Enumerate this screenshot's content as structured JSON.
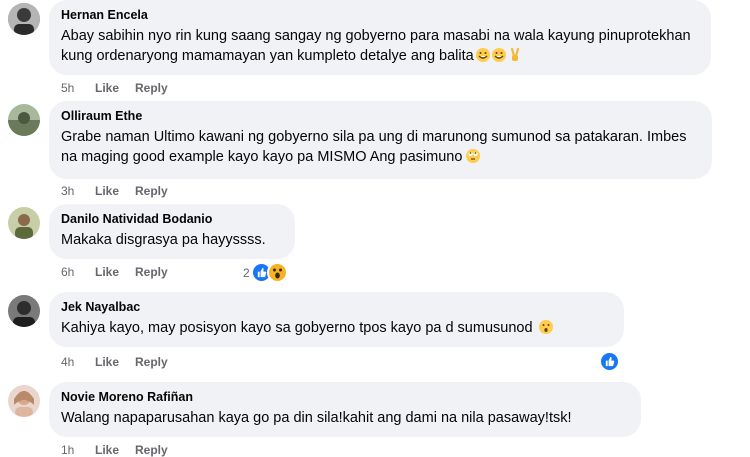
{
  "comments": [
    {
      "author": "Hernan Encela",
      "text": "Abay sabihin nyo rin kung saang sangay ng gobyerno para masabi na wala kayung pinuprotekhan kung ordenaryong mamamayan yan kumpleto detalye ang balita",
      "emojis": [
        "rolling-on-floor-laughing-emoji",
        "rolling-on-floor-laughing-emoji",
        "victory-hand-emoji"
      ],
      "time": "5h",
      "like": "Like",
      "reply": "Reply",
      "avatar_color": "#6b6b6b"
    },
    {
      "author": "Olliraum Ethe",
      "text": "Grabe naman Ultimo kawani ng gobyerno sila pa ung di marunong sumunod sa patakaran. Imbes na maging good example kayo kayo pa MISMO Ang pasimuno",
      "emojis": [
        "face-with-rolling-eyes-emoji"
      ],
      "time": "3h",
      "like": "Like",
      "reply": "Reply",
      "avatar_color": "#5b6b50"
    },
    {
      "author": "Danilo Natividad Bodanio",
      "text": "Makaka disgrasya pa hayyssss.",
      "time": "6h",
      "like": "Like",
      "reply": "Reply",
      "reaction_count": "2",
      "reactions": [
        "like-reaction-icon",
        "wow-reaction-icon"
      ],
      "avatar_color": "#8a9a6a"
    },
    {
      "author": "Jek Nayalbac",
      "text": "Kahiya kayo, may posisyon kayo sa gobyerno tpos kayo pa d sumusunod",
      "emojis": [
        "hushed-face-emoji"
      ],
      "time": "4h",
      "like": "Like",
      "reply": "Reply",
      "reactions": [
        "like-reaction-icon"
      ],
      "avatar_color": "#4a4a4a"
    },
    {
      "author": "Novie Moreno Rafiñan",
      "text": "Walang napaparusahan kaya go pa din sila!kahit ang dami na nila pasaway!tsk!",
      "time": "1h",
      "like": "Like",
      "reply": "Reply",
      "avatar_color": "#c9a89a"
    }
  ],
  "colors": {
    "bubble": "#f0f2f5",
    "meta_text": "#65676b",
    "like_blue": "#1877f2",
    "wow_yellow": "#f7b125",
    "emoji_yellow": "#ffcc4d"
  }
}
